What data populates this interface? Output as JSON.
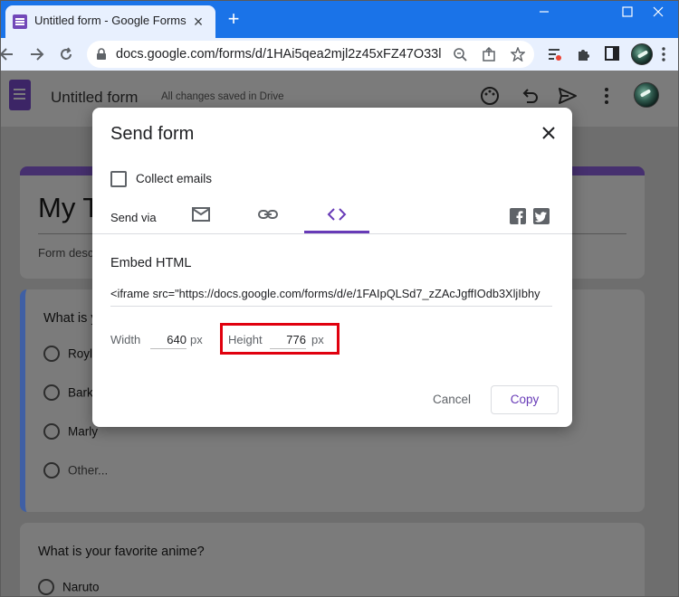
{
  "browser": {
    "tab_title": "Untitled form - Google Forms",
    "url": "docs.google.com/forms/d/1HAi5qea2mjl2z45xFZ47O33l...",
    "colors": {
      "tabstrip": "#1a73e8",
      "toolbar": "#e8f0fe"
    },
    "icons": [
      "forms-favicon-icon",
      "close-icon",
      "plus-icon",
      "minimize-icon",
      "maximize-icon",
      "window-close-icon",
      "back-icon",
      "forward-icon",
      "lock-icon",
      "zoom-icon",
      "share-icon",
      "star-icon",
      "extension-filter-icon",
      "puzzle-icon",
      "sidepanel-icon",
      "profile-avatar"
    ]
  },
  "forms_header": {
    "title": "Untitled form",
    "save_status": "All changes saved in Drive",
    "icons": [
      "forms-logo-icon",
      "palette-icon",
      "undo-icon",
      "send-icon",
      "more-vert-icon",
      "profile-avatar"
    ]
  },
  "form": {
    "title": "My T",
    "description_placeholder": "Form desc",
    "questions": [
      {
        "text": "What is y",
        "options": [
          "Royle",
          "Barky",
          "Marly",
          "Other..."
        ]
      },
      {
        "text": "What is your favorite anime?",
        "options": [
          "Naruto"
        ]
      }
    ]
  },
  "dialog": {
    "title": "Send form",
    "collect_emails_label": "Collect emails",
    "collect_emails_checked": false,
    "send_via_label": "Send via",
    "send_via_tabs": [
      "email",
      "link",
      "embed-html"
    ],
    "active_tab": "embed-html",
    "embed_label": "Embed HTML",
    "embed_code": "<iframe src=\"https://docs.google.com/forms/d/e/1FAIpQLSd7_zZAcJgffIOdb3XljIbhy",
    "width_label": "Width",
    "width_value": "640",
    "height_label": "Height",
    "height_value": "776",
    "unit": "px",
    "cancel_label": "Cancel",
    "copy_label": "Copy",
    "accent_color": "#673ab7",
    "highlight_color": "#e0000e"
  }
}
